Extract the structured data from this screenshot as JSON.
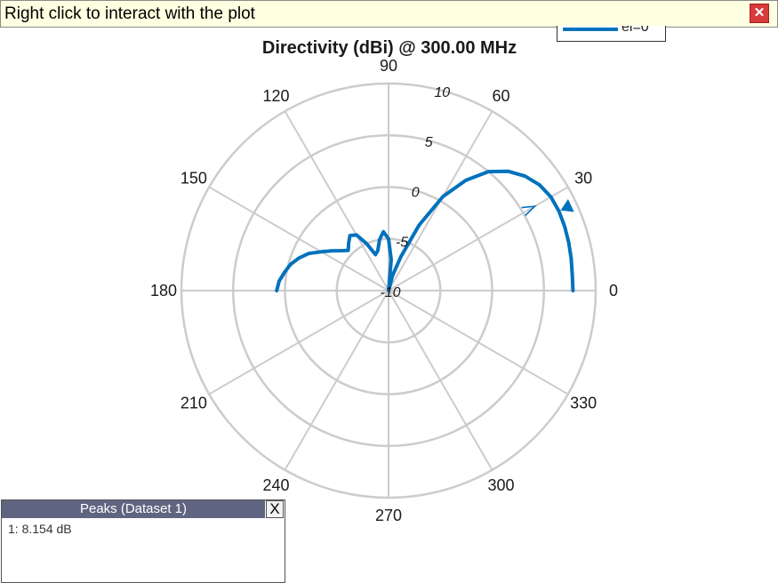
{
  "info_bar": {
    "text": "Right click to interact with the plot",
    "close_icon": "close-icon"
  },
  "legend": {
    "label": "el=0°",
    "color": "#0072bd"
  },
  "peaks_panel": {
    "title": "Peaks (Dataset 1)",
    "close_label": "X",
    "entries": [
      "1: 8.154 dB"
    ]
  },
  "colors": {
    "series": "#0072bd",
    "grid": "#cccccc",
    "info_bar_bg": "#ffffe1",
    "peaks_header_bg": "#5f6580"
  },
  "chart_data": {
    "type": "polar",
    "title": "Directivity (dBi) @ 300.00 MHz",
    "angle_unit": "deg",
    "angle_ticks": [
      0,
      30,
      60,
      90,
      120,
      150,
      180,
      210,
      240,
      270,
      300,
      330
    ],
    "radial_ticks": [
      -10,
      -5,
      0,
      5,
      10
    ],
    "rlim": [
      -10,
      10
    ],
    "grid": true,
    "series": [
      {
        "name": "el=0°",
        "angles": [
          0,
          5,
          10,
          15,
          20,
          25,
          30,
          35,
          40,
          45,
          50,
          55,
          60,
          65,
          70,
          75,
          80,
          85,
          90,
          95,
          100,
          105,
          110,
          115,
          120,
          125,
          130,
          135,
          140,
          145,
          150,
          155,
          160,
          165,
          170,
          175,
          180
        ],
        "values": [
          7.8,
          7.8,
          7.9,
          8.0,
          8.1,
          8.15,
          8.1,
          7.8,
          7.2,
          6.3,
          5.0,
          3.0,
          0.5,
          -3.0,
          -6.5,
          -8.5,
          -10,
          -7.0,
          -5.0,
          -4.3,
          -5.0,
          -6.0,
          -6.3,
          -5.0,
          -3.8,
          -3.5,
          -4.0,
          -4.5,
          -4.0,
          -3.3,
          -2.5,
          -1.5,
          -0.8,
          -0.2,
          0.2,
          0.6,
          0.8
        ]
      }
    ],
    "markers": [
      {
        "type": "peak",
        "label": "1",
        "angle": 25,
        "value": 8.154
      },
      {
        "type": "main-lobe",
        "angle": 30,
        "value": 6.3
      }
    ]
  }
}
